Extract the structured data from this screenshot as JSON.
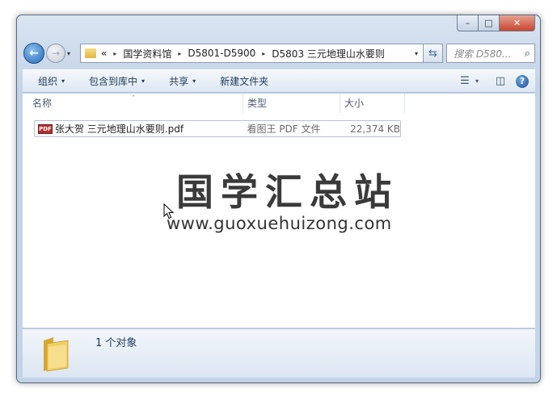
{
  "window": {
    "caption": {
      "minimize": "–",
      "maximize": "□",
      "close": "✕"
    }
  },
  "nav": {
    "back_glyph": "←",
    "forward_glyph": "→",
    "history_glyph": "▾",
    "breadcrumb_prefix": "«",
    "breadcrumbs": [
      "国学资料馆",
      "D5801-D5900",
      "D5803 三元地理山水要则"
    ],
    "separator": "▸",
    "address_dropdown": "▾",
    "refresh_glyph": "⇆",
    "search_placeholder": "搜索 D580...",
    "search_glyph": "⌕"
  },
  "toolbar": {
    "items": [
      {
        "label": "组织",
        "dropdown": "▾"
      },
      {
        "label": "包含到库中",
        "dropdown": "▾"
      },
      {
        "label": "共享",
        "dropdown": "▾"
      },
      {
        "label": "新建文件夹",
        "dropdown": ""
      }
    ],
    "views_glyph": "☰",
    "views_dropdown": "▾",
    "preview_glyph": "◫",
    "help_glyph": "?"
  },
  "columns": {
    "name": "名称",
    "type": "类型",
    "size": "大小",
    "sort_glyph": "˄"
  },
  "files": [
    {
      "icon_label": "PDF",
      "name": "张大贺 三元地理山水要则.pdf",
      "type": "看图王 PDF 文件",
      "size": "22,374 KB"
    }
  ],
  "watermark": {
    "title": "国学汇总站",
    "url": "www.guoxuehuizong.com"
  },
  "details": {
    "count": "1 个对象"
  },
  "colors": {
    "accent": "#1e395b",
    "frame": "#c4d4e8",
    "folder": "#e3b53b",
    "close": "#c8452c"
  }
}
